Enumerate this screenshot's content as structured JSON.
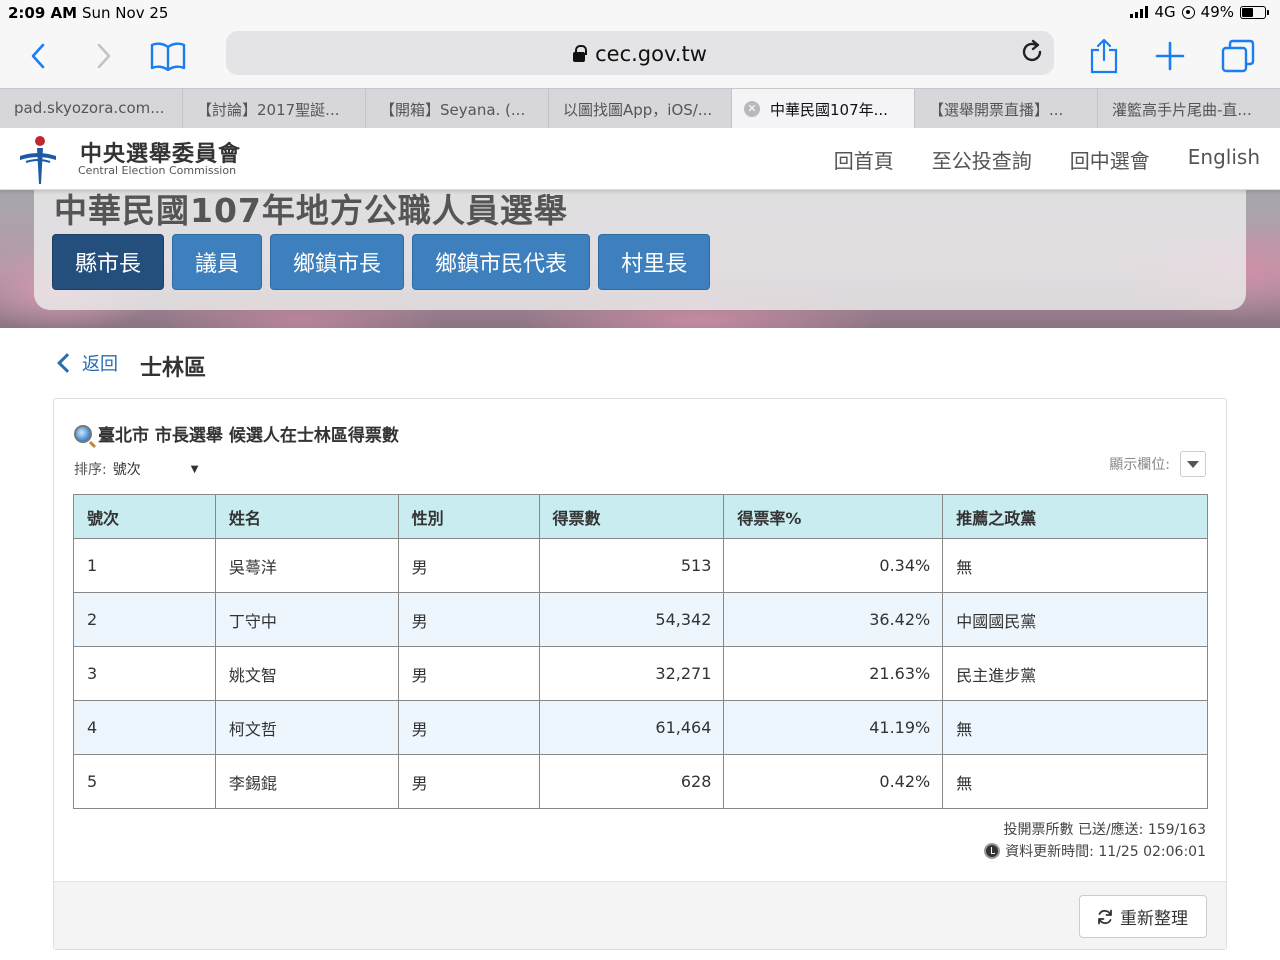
{
  "status_bar": {
    "time": "2:09 AM",
    "date": "Sun Nov 25",
    "network": "4G",
    "battery": "49%",
    "battery_level": 0.49
  },
  "browser": {
    "url": "cec.gov.tw",
    "icons": [
      "back-icon",
      "forward-icon",
      "bookmarks-icon",
      "lock-icon",
      "reload-icon",
      "share-icon",
      "new-tab-icon",
      "tabs-icon"
    ],
    "tabs": [
      {
        "label": "pad.skyozora.com..."
      },
      {
        "label": "【討論】2017聖誕..."
      },
      {
        "label": "【開箱】Seyana. (..."
      },
      {
        "label": "以圖找圖App，iOS/..."
      },
      {
        "label": "中華民國107年..."
      },
      {
        "label": "【選舉開票直播】..."
      },
      {
        "label": "灌籃高手片尾曲-直..."
      }
    ]
  },
  "site": {
    "logo_cn": "中央選舉委員會",
    "logo_en": "Central Election Commission",
    "nav": [
      "回首頁",
      "至公投查詢",
      "回中選會",
      "English"
    ],
    "banner_title": "中華民國107年地方公職人員選舉",
    "categories": [
      {
        "label": "縣市長",
        "active": true
      },
      {
        "label": "議員"
      },
      {
        "label": "鄉鎮市長"
      },
      {
        "label": "鄉鎮市民代表"
      },
      {
        "label": "村里長"
      }
    ]
  },
  "page": {
    "back_label": "返回",
    "district": "士林區",
    "card_title": "臺北市 市長選舉 候選人在士林區得票數",
    "sort_label": "排序:",
    "sort_value": "號次",
    "columns_label": "顯示欄位:",
    "refresh_label": "重新整理"
  },
  "table": {
    "headers": [
      "號次",
      "姓名",
      "性別",
      "得票數",
      "得票率%",
      "推薦之政黨"
    ],
    "rows": [
      [
        "1",
        "吳蕚洋",
        "男",
        "513",
        "0.34%",
        "無"
      ],
      [
        "2",
        "丁守中",
        "男",
        "54,342",
        "36.42%",
        "中國國民黨"
      ],
      [
        "3",
        "姚文智",
        "男",
        "32,271",
        "21.63%",
        "民主進步黨"
      ],
      [
        "4",
        "柯文哲",
        "男",
        "61,464",
        "41.19%",
        "無"
      ],
      [
        "5",
        "李錫錕",
        "男",
        "628",
        "0.42%",
        "無"
      ]
    ]
  },
  "footer_info": {
    "stations": "投開票所數 已送/應送: 159/163",
    "updated": "資料更新時間: 11/25 02:06:01"
  },
  "colors": {
    "accent": "#3e7fbd",
    "active_button": "#244f7d",
    "table_header": "#c9ecf1",
    "row_alt": "#eef6fd"
  }
}
